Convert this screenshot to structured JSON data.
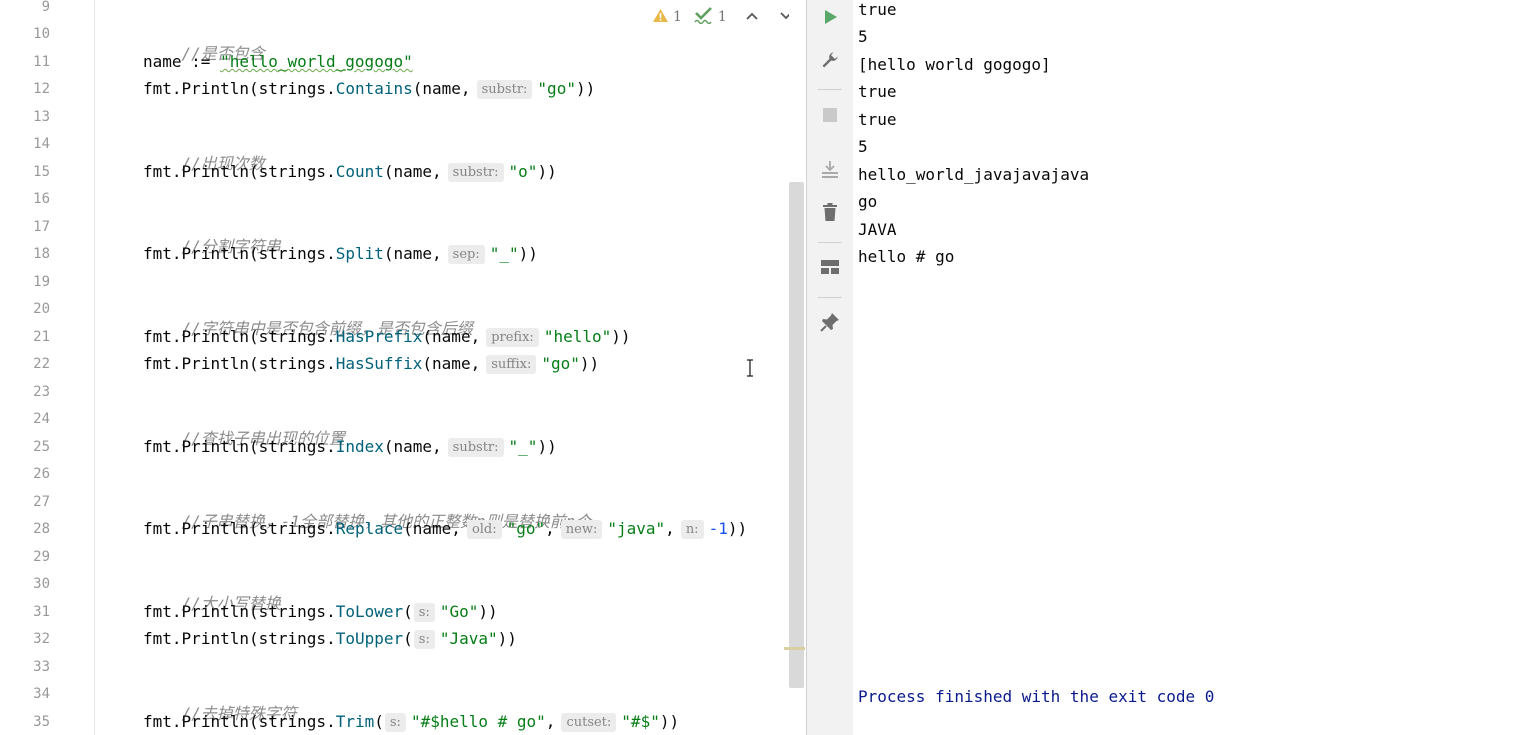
{
  "editor": {
    "line_numbers": [
      "9",
      "10",
      "11",
      "12",
      "13",
      "14",
      "15",
      "16",
      "17",
      "18",
      "19",
      "20",
      "21",
      "22",
      "23",
      "24",
      "25",
      "26",
      "27",
      "28",
      "29",
      "30",
      "31",
      "32",
      "33",
      "34",
      "35"
    ],
    "inspections": {
      "warning_count": "1",
      "weak_warning_count": "1"
    },
    "code": {
      "c10": "//是否包含",
      "l11_a": "name := ",
      "l11_str": "\"hello_world_gogogo\"",
      "fmt": "fmt",
      "dot": ".",
      "println": "Println",
      "strings": "strings",
      "l12_fn": "Contains",
      "l12_arg": "(name,",
      "l12_hint": "substr:",
      "l12_str": "\"go\"",
      "c14": "//出现次数",
      "l15_fn": "Count",
      "l15_arg": "(name,",
      "l15_hint": "substr:",
      "l15_str": "\"o\"",
      "c17": "//分割字符串",
      "l18_fn": "Split",
      "l18_arg": "(name,",
      "l18_hint": "sep:",
      "l18_str": "\"_\"",
      "c20": "//字符串中是否包含前缀，是否包含后缀",
      "l21_fn": "HasPrefix",
      "l21_arg": "(name,",
      "l21_hint": "prefix:",
      "l21_str": "\"hello\"",
      "l22_fn": "HasSuffix",
      "l22_arg": "(name,",
      "l22_hint": "suffix:",
      "l22_str": "\"go\"",
      "c24": "//查找子串出现的位置",
      "l25_fn": "Index",
      "l25_arg": "(name,",
      "l25_hint": "substr:",
      "l25_str": "\"_\"",
      "c27": "//子串替换，-1全部替换，其他的正整数n则是替换前n个",
      "l28_fn": "Replace",
      "l28_arg": "(name,",
      "l28_hint_old": "old:",
      "l28_str_old": "\"go\"",
      "l28_hint_new": "new:",
      "l28_str_new": "\"java\"",
      "l28_hint_n": "n:",
      "l28_num": "-1",
      "c30": "//大小写替换",
      "l31_fn": "ToLower",
      "l31_hint": "s:",
      "l31_str": "\"Go\"",
      "l32_fn": "ToUpper",
      "l32_hint": "s:",
      "l32_str": "\"Java\"",
      "c34": "//去掉特殊字符",
      "l35_fn": "Trim",
      "l35_hint_s": "s:",
      "l35_str_s": "\"#$hello # go\"",
      "l35_hint_cutset": "cutset:",
      "l35_str_cutset": "\"#$\"",
      "open": "(",
      "close2": "))",
      "comma": ","
    }
  },
  "run_toolbar": {
    "icons": [
      "rerun-icon",
      "wrench-icon",
      "stop-icon",
      "scroll-to-end-icon",
      "trash-icon",
      "layout-icon",
      "pin-icon"
    ]
  },
  "console": {
    "lines": [
      "true",
      "5",
      "[hello world gogogo]",
      "true",
      "true",
      "5",
      "hello_world_javajavajava",
      "go",
      "JAVA",
      "hello # go"
    ],
    "exit_message": "Process finished with the exit code 0"
  },
  "colors": {
    "comment": "#8c8c8c",
    "string": "#067d17",
    "function": "#00627a",
    "number": "#1750eb",
    "run_green": "#59a869",
    "exit_text": "#0a1a8c"
  }
}
